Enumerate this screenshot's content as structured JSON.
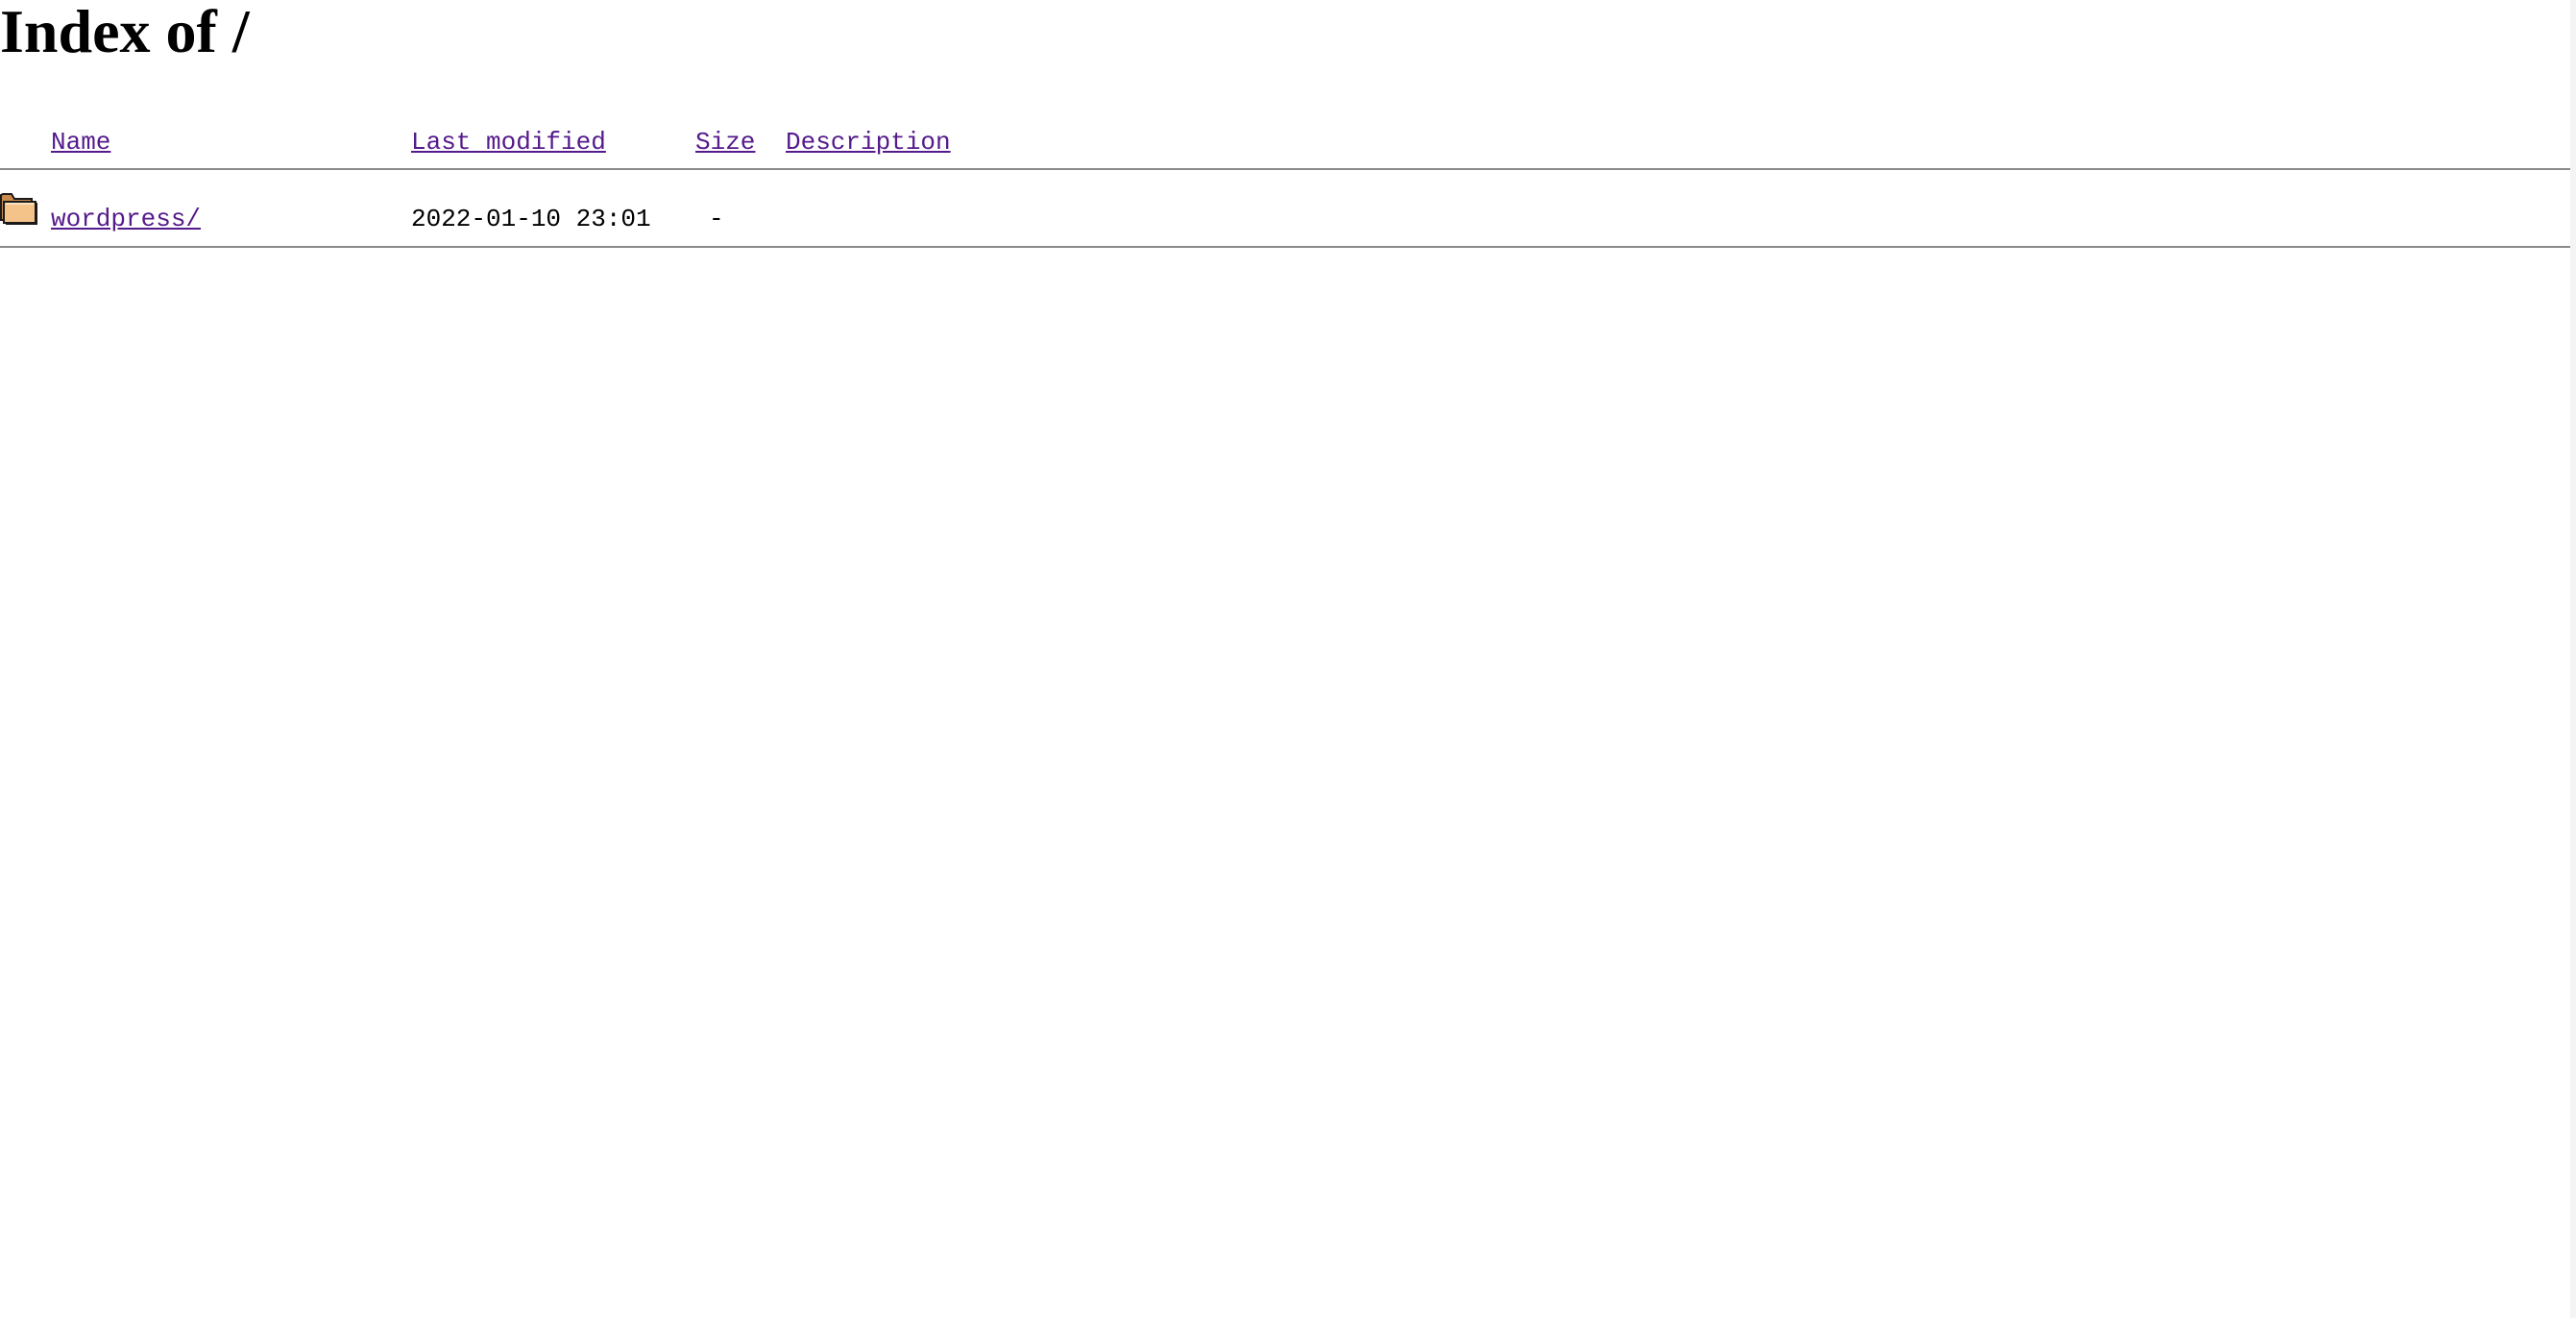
{
  "page": {
    "title": "Index of /"
  },
  "table": {
    "headers": {
      "name": "Name",
      "last_modified": "Last modified",
      "size": "Size",
      "description": "Description"
    },
    "rows": [
      {
        "icon": "folder-icon",
        "name": "wordpress/",
        "last_modified": "2022-01-10 23:01",
        "size": "-",
        "description": ""
      }
    ]
  },
  "colors": {
    "visited_link": "#551a8b",
    "rule": "#8a8a8a",
    "folder_fill": "#f4c38a",
    "folder_outline": "#1a1a1a"
  }
}
